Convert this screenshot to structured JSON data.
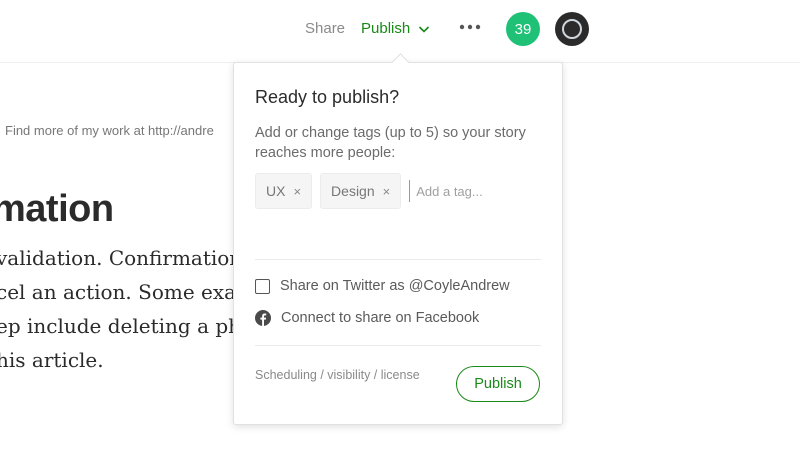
{
  "header": {
    "share_label": "Share",
    "publish_label": "Publish",
    "notification_count": "39"
  },
  "article": {
    "meta_text": "Find more of my work at http://andre",
    "heading": "mation",
    "lines": [
      "validation. Confirmation",
      "cel an action. Some exam",
      "ep include deleting a phot",
      "his article."
    ]
  },
  "publish_popover": {
    "title": "Ready to publish?",
    "description": "Add or change tags (up to 5) so your story reaches more people:",
    "tags": [
      {
        "label": "UX",
        "remove": "×"
      },
      {
        "label": "Design",
        "remove": "×"
      }
    ],
    "tag_input_placeholder": "Add a tag...",
    "twitter_label": "Share on Twitter as @CoyleAndrew",
    "facebook_label": "Connect to share on Facebook",
    "scheduling_link": "Scheduling / visibility / license",
    "publish_button": "Publish"
  },
  "colors": {
    "accent_green": "#1a8917",
    "badge_green": "#1fc176"
  },
  "icons": [
    "chevron-down-icon",
    "more-icon",
    "avatar-icon",
    "facebook-icon",
    "close-icon"
  ]
}
